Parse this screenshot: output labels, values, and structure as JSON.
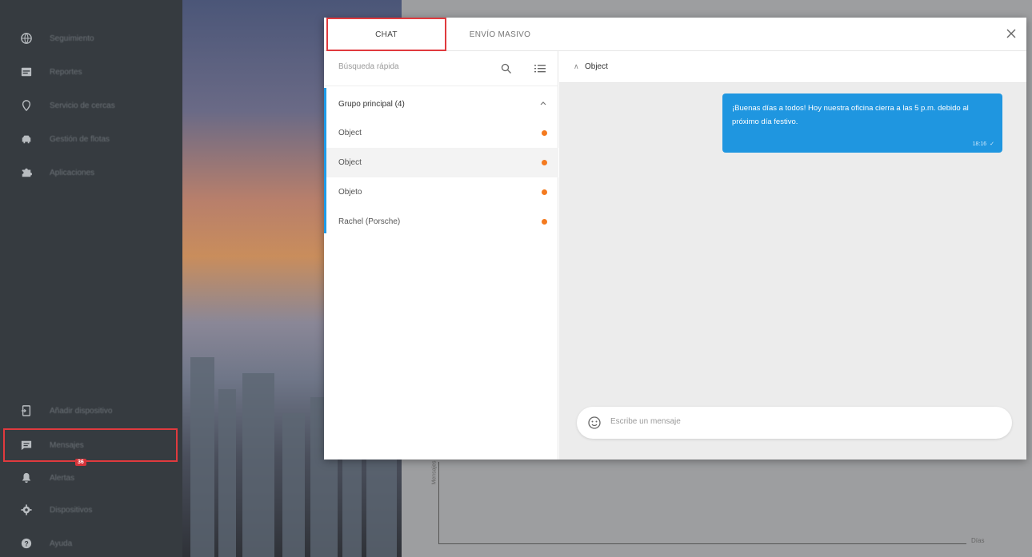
{
  "sidebar": {
    "items": [
      {
        "label": "Seguimiento",
        "icon": "globe-icon"
      },
      {
        "label": "Reportes",
        "icon": "report-icon"
      },
      {
        "label": "Servicio de cercas",
        "icon": "location-pin-icon"
      },
      {
        "label": "Gestión de flotas",
        "icon": "car-icon"
      },
      {
        "label": "Aplicaciones",
        "icon": "puzzle-icon"
      }
    ],
    "bottom_items": [
      {
        "label": "Añadir dispositivo",
        "icon": "add-device-icon"
      },
      {
        "label": "Mensajes",
        "icon": "chat-bubble-icon"
      },
      {
        "label": "Alertas",
        "icon": "bell-icon",
        "badge": "36"
      },
      {
        "label": "Dispositivos",
        "icon": "gear-icon"
      },
      {
        "label": "Ayuda",
        "icon": "help-icon"
      }
    ]
  },
  "background": {
    "chart_axis_label_x": "Días",
    "chart_axis_label_y": "Mensajes"
  },
  "chat": {
    "tabs": [
      "CHAT",
      "ENVÍO MASIVO"
    ],
    "search_placeholder": "Búsqueda rápida",
    "group": {
      "label": "Grupo principal (4)"
    },
    "contacts": [
      {
        "name": "Object",
        "status_color": "#f47a1f"
      },
      {
        "name": "Object",
        "status_color": "#f47a1f"
      },
      {
        "name": "Objeto",
        "status_color": "#f47a1f"
      },
      {
        "name": "Rachel (Porsche)",
        "status_color": "#f47a1f"
      }
    ],
    "conversation": {
      "header_name": "Object",
      "messages": [
        {
          "text": "¡Buenas días a todos! Hoy nuestra oficina cierra a las 5 p.m. debido al próximo día festivo.",
          "time": "18:16",
          "status": "✓"
        }
      ]
    },
    "composer_placeholder": "Escribe un mensaje"
  },
  "colors": {
    "accent": "#1f96e0",
    "highlight_border": "#e03a3e",
    "status_dot": "#f47a1f",
    "sidebar_bg": "#363b40"
  }
}
